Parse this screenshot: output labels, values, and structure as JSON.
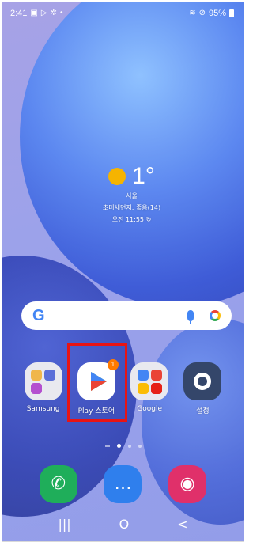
{
  "status_bar": {
    "time": "2:41",
    "battery": "95%"
  },
  "weather": {
    "temperature": "1°",
    "city": "서울",
    "air_quality": "초미세먼지: 좋음(14)",
    "updated": "오전 11:55 ↻"
  },
  "search_bar": {
    "logo": "G"
  },
  "apps": [
    {
      "label": "Samsung"
    },
    {
      "label": "Play 스토어",
      "badge": "1"
    },
    {
      "label": "Google"
    },
    {
      "label": "설정"
    }
  ],
  "dock": [
    {
      "icon": "phone-icon"
    },
    {
      "icon": "messages-icon"
    },
    {
      "icon": "camera-icon"
    }
  ],
  "nav": {
    "recents": "|||",
    "home": "O",
    "back": "<"
  },
  "colors": {
    "highlight": "#e81414",
    "badge": "#ff7a00"
  }
}
